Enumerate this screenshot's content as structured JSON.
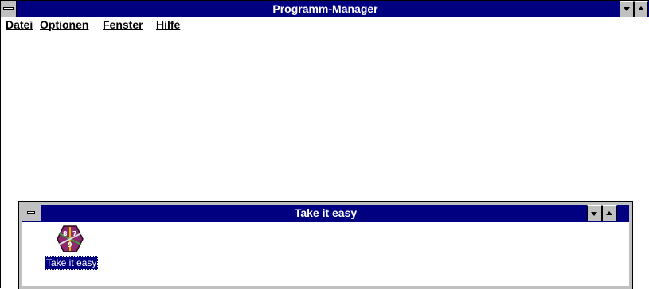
{
  "main_window": {
    "title": "Programm-Manager",
    "menu": [
      {
        "label": "Datei"
      },
      {
        "label": "Optionen"
      },
      {
        "label": "Fenster"
      },
      {
        "label": "Hilfe"
      }
    ]
  },
  "group_window": {
    "title": "Take it easy",
    "icons": [
      {
        "label": "Take it easy",
        "icon": "take-it-easy-hexagon-icon",
        "selected": true
      }
    ]
  },
  "colors": {
    "titlebar": "#000080",
    "button_face": "#c0c0c0",
    "icon_hexagon": "#8b2a6f",
    "selection": "#000080"
  }
}
